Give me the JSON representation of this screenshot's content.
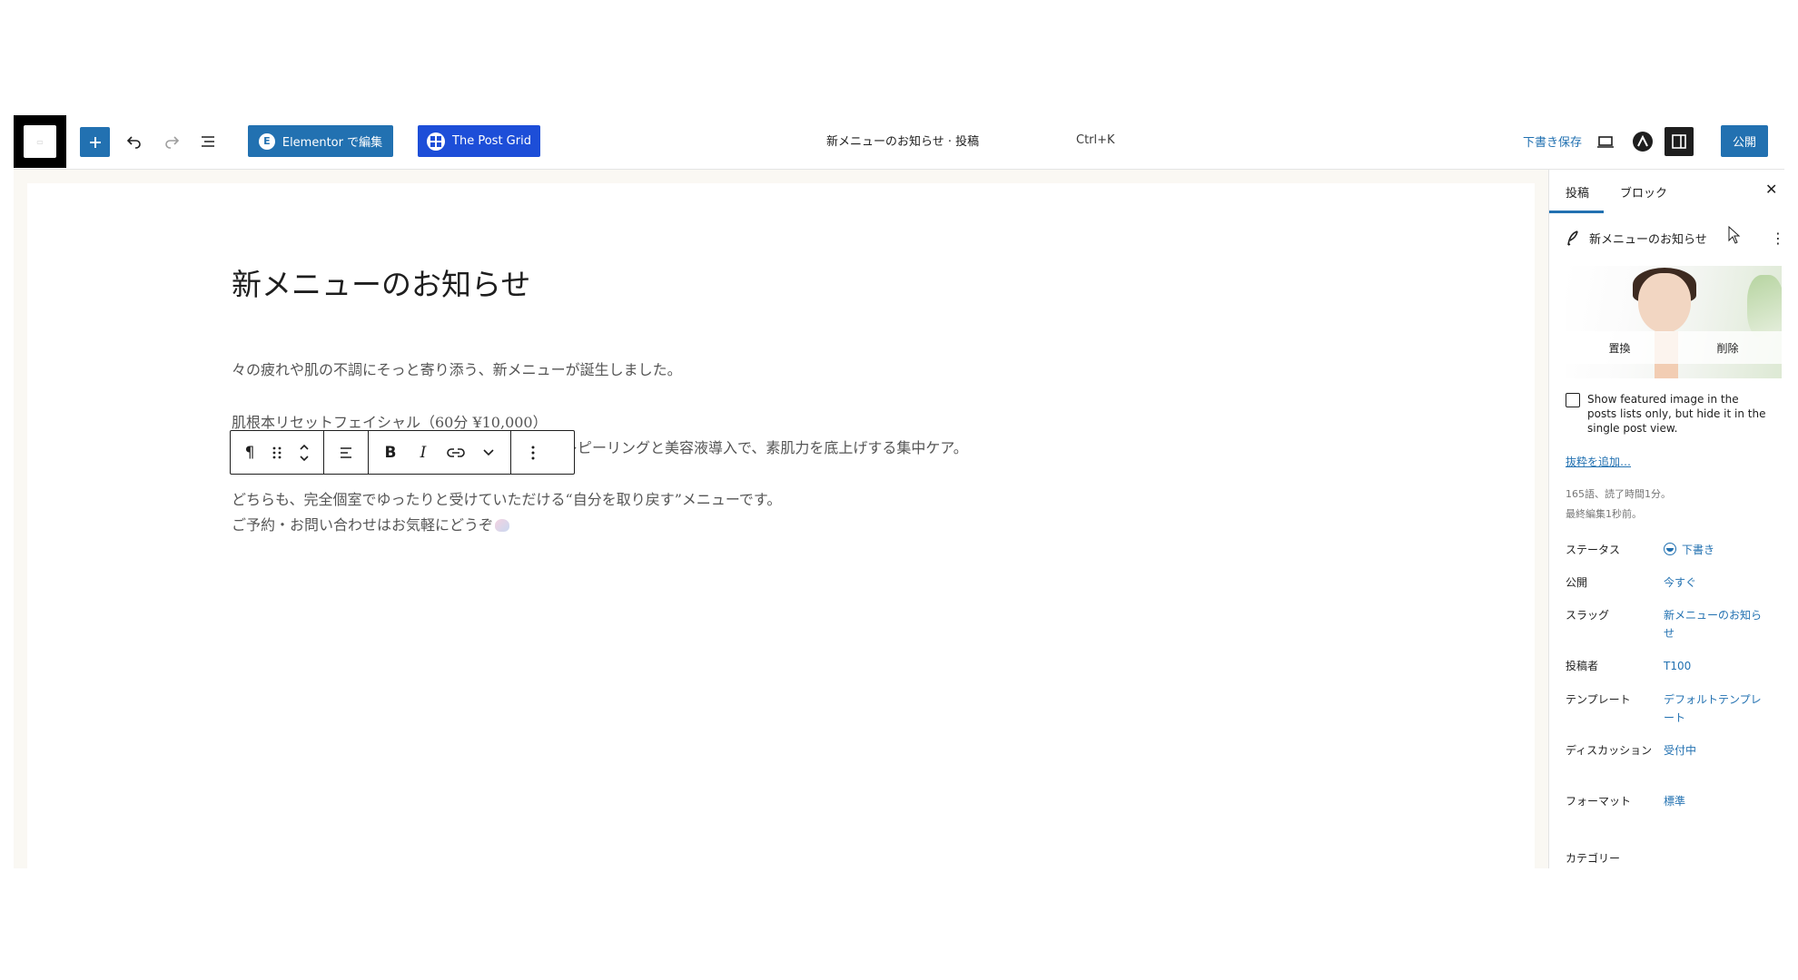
{
  "toolbar": {
    "elementor_label": "Elementor で編集",
    "elementor_icon": "elementor-icon",
    "post_grid_label": "The Post Grid",
    "post_grid_icon": "post-grid-icon",
    "document_title": "新メニューのお知らせ · 投稿",
    "command_shortcut": "Ctrl+K",
    "save_draft_label": "下書き保存",
    "publish_label": "公開",
    "icons": [
      "wordpress-logo-icon",
      "add-block-icon",
      "undo-icon",
      "redo-icon",
      "document-overview-icon",
      "preview-device-icon",
      "astra-icon",
      "settings-sidebar-icon"
    ]
  },
  "post": {
    "title": "新メニューのお知らせ",
    "paragraphs": [
      "々の疲れや肌の不調にそっと寄り添う、新メニューが誕生しました。",
      "肌根本リセットフェイシャル（60分 ¥10,000）",
      "レピーリングと美容液導入で、素肌力を底上げする集中ケア。",
      "どちらも、完全個室でゆったりと受けていただける“自分を取り戻す”メニューです。",
      "ご予約・お問い合わせはお気軽にどうぞ"
    ]
  },
  "block_toolbar": {
    "items": [
      "paragraph-icon",
      "drag-handle-icon",
      "move-up-down-icon",
      "align-icon",
      "bold-icon",
      "italic-icon",
      "link-icon",
      "more-rich-text-icon",
      "options-icon"
    ],
    "bold_label": "B",
    "italic_label": "I"
  },
  "sidebar": {
    "tabs": [
      "投稿",
      "ブロック"
    ],
    "active_tab": "投稿",
    "post_name": "新メニューのお知らせ",
    "featured_image": {
      "replace_label": "置換",
      "remove_label": "削除"
    },
    "show_featured_option": "Show featured image in the posts lists only, but hide it in the single post view.",
    "add_excerpt_label": "抜粋を追加…",
    "word_count": "165語、読了時間1分。",
    "last_edited": "最終編集1秒前。",
    "properties": [
      {
        "label": "ステータス",
        "value": "下書き"
      },
      {
        "label": "公開",
        "value": "今すぐ"
      },
      {
        "label": "スラッグ",
        "value": "新メニューのお知らせ"
      },
      {
        "label": "投稿者",
        "value": "T100"
      },
      {
        "label": "テンプレート",
        "value": "デフォルトテンプレート"
      },
      {
        "label": "ディスカッション",
        "value": "受付中"
      },
      {
        "label": "フォーマット",
        "value": "標準"
      }
    ],
    "next_section_label": "カテゴリー"
  },
  "colors": {
    "accent": "#2271b1",
    "post_grid": "#1d4ed8",
    "canvas_bg": "#faf8f3"
  }
}
